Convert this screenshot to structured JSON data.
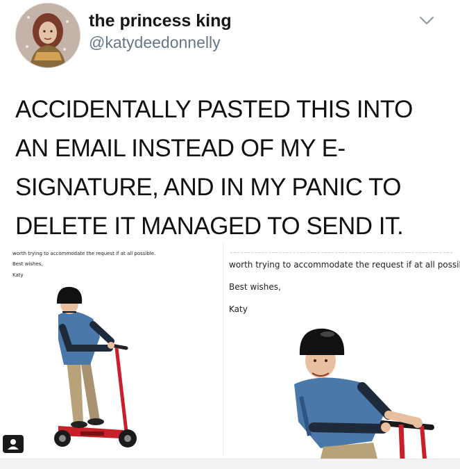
{
  "tweet": {
    "display_name": "the princess king",
    "handle": "@katydeedonnelly",
    "text_lines": [
      "ACCIDENTALLY PASTED THIS INTO",
      "AN EMAIL INSTEAD OF MY E-",
      "SIGNATURE, AND IN MY PANIC TO",
      "DELETE IT MANAGED TO SEND IT."
    ]
  },
  "media": {
    "left": {
      "line1": "worth trying to accommodate the request if at all possible.",
      "line2": "Best wishes,",
      "line3": "Katy"
    },
    "right": {
      "line1": "worth trying to accommodate the request if at all possible.",
      "line2": "Best wishes,",
      "line3": "Katy"
    }
  },
  "icons": {
    "caret": "chevron-down-icon",
    "photo": "photo-icon",
    "avatar": "profile-avatar"
  },
  "colors": {
    "name": "#14171a",
    "handle": "#657786",
    "scooter": "#c8202a",
    "shirt": "#4a78a8"
  }
}
